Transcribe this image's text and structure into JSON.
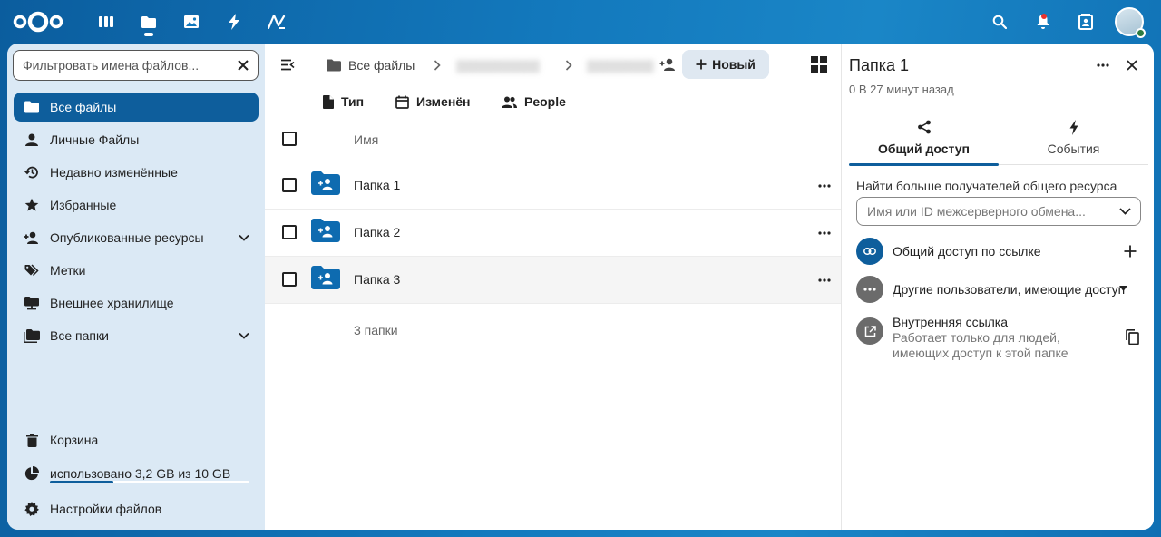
{
  "header": {
    "apps": [
      {
        "icon": "dashboard-icon",
        "name": "dashboard"
      },
      {
        "icon": "files-icon",
        "name": "files",
        "active": true
      },
      {
        "icon": "photos-icon",
        "name": "photos"
      },
      {
        "icon": "activity-icon",
        "name": "activity"
      },
      {
        "icon": "notes-icon",
        "name": "notes"
      }
    ],
    "right": [
      "search-icon",
      "bell-icon",
      "contacts-icon",
      "avatar"
    ]
  },
  "nav": {
    "filter_placeholder": "Фильтровать имена файлов...",
    "items": [
      {
        "label": "Все файлы",
        "icon": "folder-icon",
        "active": true
      },
      {
        "label": "Личные Файлы",
        "icon": "user-icon"
      },
      {
        "label": "Недавно изменённые",
        "icon": "history-icon"
      },
      {
        "label": "Избранные",
        "icon": "star-icon"
      },
      {
        "label": "Опубликованные ресурсы",
        "icon": "share-person-icon",
        "expandable": true
      },
      {
        "label": "Метки",
        "icon": "tags-icon"
      },
      {
        "label": "Внешнее хранилище",
        "icon": "external-storage-icon"
      },
      {
        "label": "Все папки",
        "icon": "folder-multiple-icon",
        "expandable": true
      }
    ],
    "trash": "Корзина",
    "quota": {
      "label": "использовано 3,2 GB из 10 GB",
      "fraction": 0.32
    },
    "settings": "Настройки файлов"
  },
  "files": {
    "breadcrumb": {
      "root": "Все файлы"
    },
    "new_button": "Новый",
    "filters": [
      "Тип",
      "Изменён",
      "People"
    ],
    "column_name": "Имя",
    "rows": [
      {
        "name": "Папка 1"
      },
      {
        "name": "Папка 2"
      },
      {
        "name": "Папка 3"
      }
    ],
    "summary": "3 папки"
  },
  "sidebar": {
    "title": "Папка 1",
    "subtitle": "0 В 27 минут назад",
    "tabs": [
      {
        "label": "Общий доступ",
        "icon": "share-icon",
        "active": true
      },
      {
        "label": "События",
        "icon": "activity-icon"
      }
    ],
    "search_label": "Найти больше получателей общего ресурса",
    "search_placeholder": "Имя или ID межсерверного обмена...",
    "entries": {
      "link": "Общий доступ по ссылке",
      "others": "Другие пользователи, имеющие доступ",
      "internal_title": "Внутренняя ссылка",
      "internal_desc": "Работает только для людей, имеющих доступ к этой папке"
    }
  },
  "colors": {
    "primary": "#0e5e9c",
    "header_bg": "#1379bd",
    "nav_bg": "#d9e8f4",
    "others_circle": "#6b6b6b"
  }
}
